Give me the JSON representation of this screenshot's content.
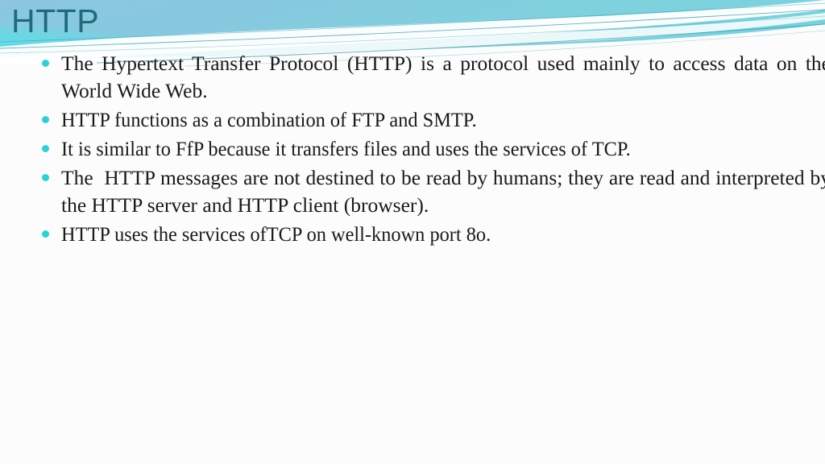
{
  "slide": {
    "title": "HTTP",
    "title_color": "#1f6b78",
    "background_color": "#fcfcfc",
    "body_text_color": "#1a1a1a"
  },
  "theme": {
    "banner_gradient_left": "#87c4de",
    "banner_gradient_mid": "#7fd2dd",
    "banner_gradient_right": "#79d2dd",
    "banner_accent_cyan": "#4fe0e8",
    "banner_swoosh_white": "#ffffff",
    "banner_hairline_teal": "#2e8fa0",
    "bullet_color": "#2ad2d8"
  },
  "bullets": [
    {
      "marker": "bullet-dot",
      "text": "The Hypertext Transfer Protocol (HTTP) is a protocol used mainly to access data on the World Wide Web.",
      "wraps": true
    },
    {
      "marker": "bullet-dot",
      "text": "HTTP functions as a combination of FTP and SMTP.",
      "wraps": false
    },
    {
      "marker": "bullet-dot",
      "text": "It is similar to FfP because it transfers files and uses the services of TCP.",
      "wraps": false
    },
    {
      "marker": "bullet-dot",
      "text": "The  HTTP messages are not destined to be read by humans; they are read and interpreted by the HTTP server and HTTP client (browser).",
      "wraps": true
    },
    {
      "marker": "bullet-dot",
      "text": "HTTP uses the services ofTCP on well-known port 8o.",
      "wraps": false
    }
  ]
}
